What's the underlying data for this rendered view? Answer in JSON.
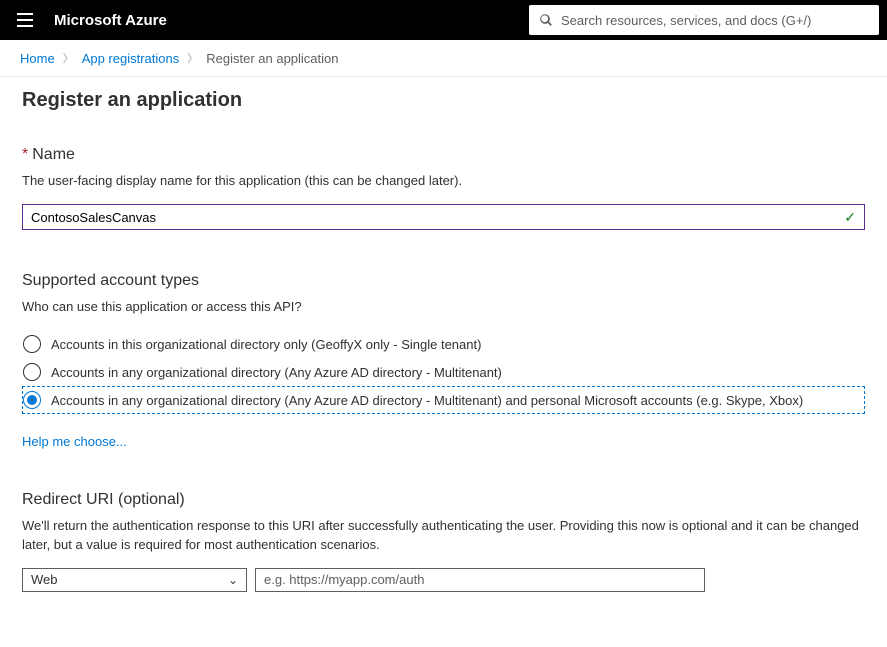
{
  "topbar": {
    "brand": "Microsoft Azure",
    "search_placeholder": "Search resources, services, and docs (G+/)"
  },
  "breadcrumb": {
    "items": [
      "Home",
      "App registrations",
      "Register an application"
    ]
  },
  "page": {
    "title": "Register an application"
  },
  "name_section": {
    "label": "Name",
    "required_mark": "*",
    "desc": "The user-facing display name for this application (this can be changed later).",
    "value": "ContosoSalesCanvas"
  },
  "account_types": {
    "title": "Supported account types",
    "desc": "Who can use this application or access this API?",
    "options": [
      "Accounts in this organizational directory only (GeoffyX only - Single tenant)",
      "Accounts in any organizational directory (Any Azure AD directory - Multitenant)",
      "Accounts in any organizational directory (Any Azure AD directory - Multitenant) and personal Microsoft accounts (e.g. Skype, Xbox)"
    ],
    "selected_index": 2,
    "help_link": "Help me choose..."
  },
  "redirect_uri": {
    "title": "Redirect URI (optional)",
    "desc": "We'll return the authentication response to this URI after successfully authenticating the user. Providing this now is optional and it can be changed later, but a value is required for most authentication scenarios.",
    "platform_selected": "Web",
    "uri_placeholder": "e.g. https://myapp.com/auth",
    "uri_value": ""
  }
}
